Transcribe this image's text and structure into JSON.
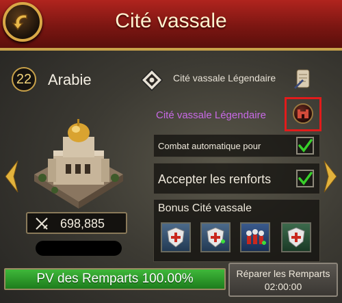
{
  "header": {
    "title": "Cité vassale"
  },
  "city": {
    "level": "22",
    "region": "Arabie",
    "power": "698,885"
  },
  "status": {
    "title_label": "Cité vassale Légendaire",
    "legendary_label": "Cité vassale Légendaire",
    "legendary_color": "#c86ae6"
  },
  "options": {
    "auto_combat": {
      "label": "Combat automatique pour",
      "checked": true
    },
    "accept_reinforcements": {
      "label": "Accepter les renforts",
      "checked": true
    }
  },
  "bonus": {
    "title": "Bonus Cité vassale",
    "icons": [
      "shield-heal-icon",
      "shield-plus-icon",
      "troops-icon",
      "shield-heal-icon"
    ]
  },
  "walls": {
    "hp_label": "PV des Remparts 100.00%",
    "hp_percent": 100
  },
  "repair": {
    "label": "Réparer les Remparts",
    "time": "02:00:00"
  },
  "colors": {
    "header_red": "#9a1c17",
    "gold": "#c9a24a",
    "hp_green": "#2f9a2c",
    "highlight_red": "#e21b1b"
  }
}
